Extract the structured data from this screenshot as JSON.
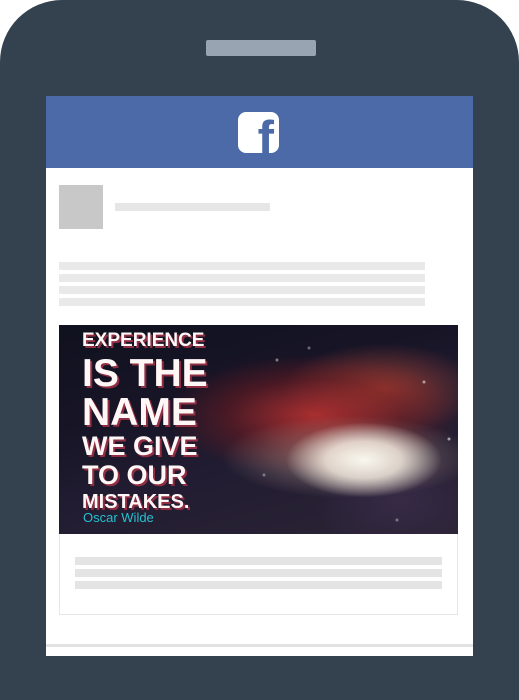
{
  "app": {
    "name": "Facebook",
    "logo_letter": "f",
    "colors": {
      "phone_frame": "#34424f",
      "brand_blue": "#4b6aa7",
      "quote_accent": "#24c1cf",
      "placeholder_gray": "#e6e6e6"
    }
  },
  "post": {
    "avatar_icon": "avatar-placeholder",
    "name_placeholder": "",
    "text_placeholder_lines": [
      "",
      "",
      "",
      ""
    ],
    "card_text_placeholder_lines": [
      "",
      "",
      ""
    ],
    "quote": {
      "lines": [
        "EXPERIENCE",
        "IS THE",
        "NAME",
        "WE GIVE",
        "TO OUR",
        "MISTAKES."
      ],
      "author": "Oscar Wilde"
    }
  }
}
